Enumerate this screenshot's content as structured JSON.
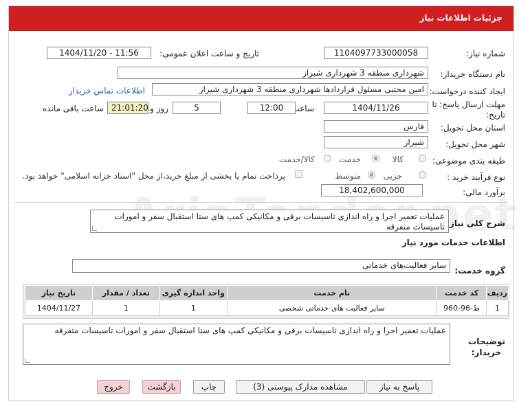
{
  "header": {
    "title": "جزئیات اطلاعات نیاز"
  },
  "form": {
    "need_number_label": "شماره نیاز:",
    "need_number": "1104097733000058",
    "announce_label": "تاریخ و ساعت اعلان عمومی:",
    "announce_value": "1404/11/20 - 11:56",
    "buyer_label": "نام دستگاه خریدار:",
    "buyer_value": "شهرداری منطقه 3 شهرداری شیراز",
    "creator_label": "ایجاد کننده درخواست:",
    "creator_value": "امین مجتبی مسئول قراردادها شهرداری منطقه 3 شهرداری شیراز",
    "contact_link": "اطلاعات تماس خریدار",
    "deadline_label_1": "مهلت ارسال پاسخ: تا",
    "deadline_label_2": "تاریخ:",
    "deadline_date": "1404/11/26",
    "time_label": "ساعت",
    "deadline_time": "12:00",
    "days_value": "5",
    "days_label": "روز و",
    "remaining_time": "21:01:20",
    "remaining_label": "ساعت باقی مانده",
    "province_label": "استان محل تحویل:",
    "province_value": "فارس",
    "city_label": "شهر محل تحویل:",
    "city_value": "شیراز",
    "category_label": "طبقه بندی موضوعی:",
    "category_options": [
      "کالا",
      "خدمت",
      "کالا/خدمت"
    ],
    "category_selected": "خدمت",
    "process_label": "نوع فرآیند خرید :",
    "process_options": [
      "جزیی",
      "متوسط"
    ],
    "process_selected": "متوسط",
    "payment_note": "پرداخت تمام یا بخشی از مبلغ خرید،از محل \"اسناد خزانه اسلامی\" خواهد بود.",
    "budget_label": "برآورد مالی:",
    "budget_value": "18,402,600,000"
  },
  "description": {
    "label": "شرح کلی نیاز:",
    "value": "عملیات تعمیر اجرا و راه اندازی تاسیسات برقی و مکانیکی کمپ های ستا استقبال سفر و امورات تاسیسات متفرقه"
  },
  "services": {
    "section_title": "اطلاعات خدمات مورد نیاز",
    "group_label": "گروه خدمت:",
    "group_value": "سایر فعالیت‌های خدماتی",
    "columns": [
      "ردیف",
      "کد خدمت",
      "نام خدمت",
      "واحد اندازه گیری",
      "تعداد / مقدار",
      "تاریخ نیاز"
    ],
    "rows": [
      [
        "1",
        "ط-96-960",
        "سایر فعالیت های خدماتی شخصی",
        "1",
        "1",
        "1404/11/27"
      ]
    ]
  },
  "buyer_notes": {
    "label_1": "توضیحات",
    "label_2": "خریدار:",
    "value": "عملیات تعمیر اجرا و راه اندازی تاسیسات برقی و مکانیکی کمپ های ستا استقبال سفر و امورات تاسیسات متفرقه"
  },
  "buttons": {
    "reply": "پاسخ به نیاز",
    "documents": "مشاهده مدارک پیوستی (3)",
    "print": "چاپ",
    "back": "بازگشت",
    "exit": "خروج"
  },
  "watermark": "AriaTender.net",
  "colors": {
    "header_red": "#cf1f1f",
    "highlight_yellow": "#f3f1c2",
    "link_blue": "#1a5fb4"
  }
}
